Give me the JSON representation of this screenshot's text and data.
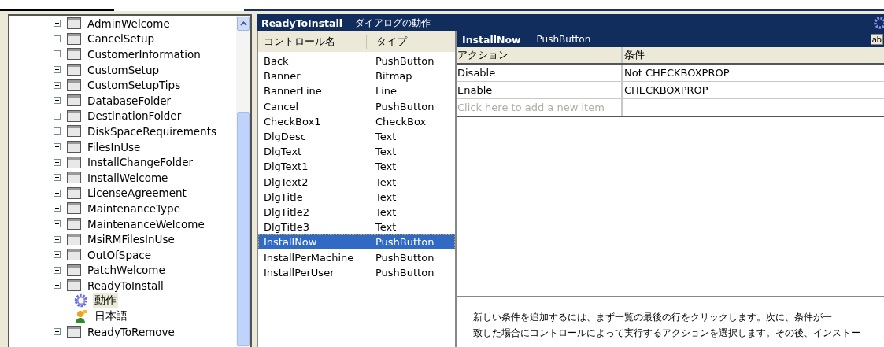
{
  "tree": {
    "items": [
      {
        "label": "AdminWelcome",
        "kind": "dialog",
        "expanded": false,
        "selected": false
      },
      {
        "label": "CancelSetup",
        "kind": "dialog",
        "expanded": false,
        "selected": false
      },
      {
        "label": "CustomerInformation",
        "kind": "dialog",
        "expanded": false,
        "selected": false
      },
      {
        "label": "CustomSetup",
        "kind": "dialog",
        "expanded": false,
        "selected": false
      },
      {
        "label": "CustomSetupTips",
        "kind": "dialog",
        "expanded": false,
        "selected": false
      },
      {
        "label": "DatabaseFolder",
        "kind": "dialog",
        "expanded": false,
        "selected": false
      },
      {
        "label": "DestinationFolder",
        "kind": "dialog",
        "expanded": false,
        "selected": false
      },
      {
        "label": "DiskSpaceRequirements",
        "kind": "dialog",
        "expanded": false,
        "selected": false
      },
      {
        "label": "FilesInUse",
        "kind": "dialog",
        "expanded": false,
        "selected": false
      },
      {
        "label": "InstallChangeFolder",
        "kind": "dialog",
        "expanded": false,
        "selected": false
      },
      {
        "label": "InstallWelcome",
        "kind": "dialog",
        "expanded": false,
        "selected": false
      },
      {
        "label": "LicenseAgreement",
        "kind": "dialog",
        "expanded": false,
        "selected": false
      },
      {
        "label": "MaintenanceType",
        "kind": "dialog",
        "expanded": false,
        "selected": false
      },
      {
        "label": "MaintenanceWelcome",
        "kind": "dialog",
        "expanded": false,
        "selected": false
      },
      {
        "label": "MsiRMFilesInUse",
        "kind": "dialog",
        "expanded": false,
        "selected": false
      },
      {
        "label": "OutOfSpace",
        "kind": "dialog",
        "expanded": false,
        "selected": false
      },
      {
        "label": "PatchWelcome",
        "kind": "dialog",
        "expanded": false,
        "selected": false
      },
      {
        "label": "ReadyToInstall",
        "kind": "dialog",
        "expanded": true,
        "selected": false,
        "children": [
          {
            "label": "動作",
            "kind": "behavior",
            "selected": true
          },
          {
            "label": "日本語",
            "kind": "language",
            "selected": false
          }
        ]
      },
      {
        "label": "ReadyToRemove",
        "kind": "dialog",
        "expanded": false,
        "selected": false
      }
    ]
  },
  "dialog_header": {
    "name": "ReadyToInstall",
    "subtitle": "ダイアログの動作"
  },
  "controls": {
    "columns": [
      "コントロール名",
      "タイプ"
    ],
    "rows": [
      {
        "name": "Back",
        "type": "PushButton",
        "selected": false
      },
      {
        "name": "Banner",
        "type": "Bitmap",
        "selected": false
      },
      {
        "name": "BannerLine",
        "type": "Line",
        "selected": false
      },
      {
        "name": "Cancel",
        "type": "PushButton",
        "selected": false
      },
      {
        "name": "CheckBox1",
        "type": "CheckBox",
        "selected": false
      },
      {
        "name": "DlgDesc",
        "type": "Text",
        "selected": false
      },
      {
        "name": "DlgText",
        "type": "Text",
        "selected": false
      },
      {
        "name": "DlgText1",
        "type": "Text",
        "selected": false
      },
      {
        "name": "DlgText2",
        "type": "Text",
        "selected": false
      },
      {
        "name": "DlgTitle",
        "type": "Text",
        "selected": false
      },
      {
        "name": "DlgTitle2",
        "type": "Text",
        "selected": false
      },
      {
        "name": "DlgTitle3",
        "type": "Text",
        "selected": false
      },
      {
        "name": "InstallNow",
        "type": "PushButton",
        "selected": true
      },
      {
        "name": "InstallPerMachine",
        "type": "PushButton",
        "selected": false
      },
      {
        "name": "InstallPerUser",
        "type": "PushButton",
        "selected": false
      }
    ]
  },
  "control_header": {
    "name": "InstallNow",
    "type": "PushButton",
    "button": "ab"
  },
  "conditions": {
    "columns": [
      "アクション",
      "条件"
    ],
    "rows": [
      {
        "action": "Disable",
        "condition": "Not CHECKBOXPROP"
      },
      {
        "action": "Enable",
        "condition": "CHECKBOXPROP"
      }
    ],
    "placeholder": "Click here to add a new item"
  },
  "help_lines": [
    "新しい条件を追加するには、まず一覧の最後の行をクリックします。次に、条件が一",
    "致した場合にコントロールによって実行するアクションを選択します。その後、インストー"
  ]
}
